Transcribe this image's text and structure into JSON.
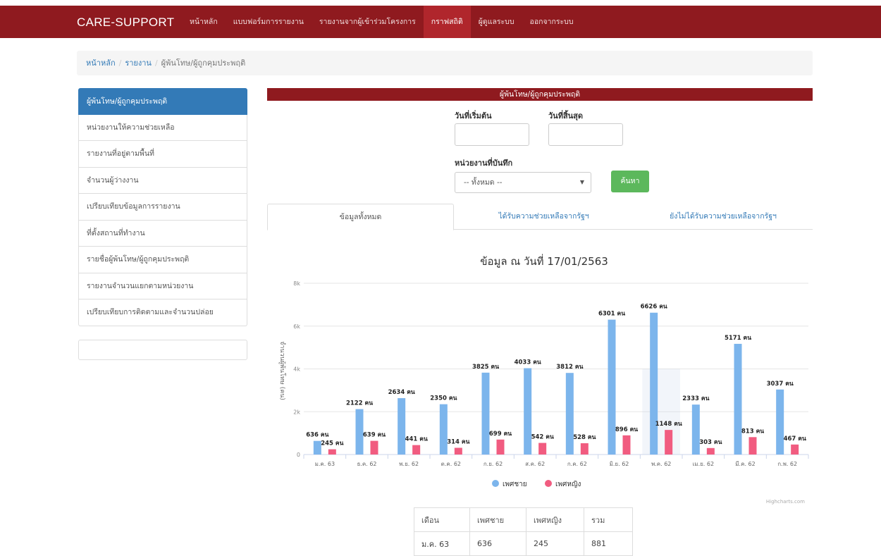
{
  "navbar": {
    "brand": "CARE-SUPPORT",
    "items": [
      {
        "label": "หน้าหลัก"
      },
      {
        "label": "แบบฟอร์มการรายงาน"
      },
      {
        "label": "รายงานจากผู้เข้าร่วมโครงการ"
      },
      {
        "label": "กราฟสถิติ"
      },
      {
        "label": "ผู้ดูแลระบบ"
      },
      {
        "label": "ออกจากระบบ"
      }
    ]
  },
  "breadcrumb": {
    "home": "หน้าหลัก",
    "report": "รายงาน",
    "current": "ผู้พ้นโทษ/ผู้ถูกคุมประพฤติ"
  },
  "sidebar": {
    "items": [
      {
        "label": "ผู้พ้นโทษ/ผู้ถูกคุมประพฤติ"
      },
      {
        "label": "หน่วยงานให้ความช่วยเหลือ"
      },
      {
        "label": "รายงานที่อยู่ตามพื้นที่"
      },
      {
        "label": "จำนวนผู้ว่างงาน"
      },
      {
        "label": "เปรียบเทียบข้อมูลการรายงาน"
      },
      {
        "label": "ที่ตั้งสถานที่ทำงาน"
      },
      {
        "label": "รายชื่อผู้พ้นโทษ/ผู้ถูกคุมประพฤติ"
      },
      {
        "label": "รายงานจำนวนแยกตามหน่วยงาน"
      },
      {
        "label": "เปรียบเทียบการติดตามและจำนวนปล่อย"
      }
    ]
  },
  "panel": {
    "heading": "ผู้พ้นโทษ/ผู้ถูกคุมประพฤติ"
  },
  "form": {
    "start_label": "วันที่เริ่มต้น",
    "end_label": "วันที่สิ้นสุด",
    "unit_label": "หน่วยงานที่บันทึก",
    "unit_value": "-- ทั้งหมด --",
    "search_label": "ค้นหา"
  },
  "tabs": [
    {
      "label": "ข้อมูลทั้งหมด"
    },
    {
      "label": "ได้รับความช่วยเหลือจากรัฐฯ"
    },
    {
      "label": "ยังไม่ได้รับความช่วยเหลือจากรัฐฯ"
    }
  ],
  "chart_data": {
    "type": "bar",
    "title": "ข้อมูล ณ วันที่ 17/01/2563",
    "ylabel": "จำนวนผู้พ้นโทษ (คน)",
    "ylim": [
      0,
      8000
    ],
    "yticks": [
      "0",
      "2k",
      "4k",
      "6k",
      "8k"
    ],
    "categories": [
      "ม.ค. 63",
      "ธ.ค. 62",
      "พ.ย. 62",
      "ต.ค. 62",
      "ก.ย. 62",
      "ส.ค. 62",
      "ก.ค. 62",
      "มิ.ย. 62",
      "พ.ค. 62",
      "เม.ย. 62",
      "มี.ค. 62",
      "ก.พ. 62"
    ],
    "series": [
      {
        "name": "เพศชาย",
        "color": "#7cb5ec",
        "values": [
          636,
          2122,
          2634,
          2350,
          3825,
          4033,
          3812,
          6301,
          6626,
          2333,
          5171,
          3037
        ],
        "labels": [
          "636 คน",
          "2122 คน",
          "2634 คน",
          "2350 คน",
          "3825 คน",
          "4033 คน",
          "3812 คน",
          "6301 คน",
          "6626 คน",
          "2333 คน",
          "5171 คน",
          "3037 คน"
        ]
      },
      {
        "name": "เพศหญิง",
        "color": "#f15c80",
        "values": [
          245,
          639,
          441,
          314,
          699,
          542,
          528,
          896,
          1148,
          303,
          813,
          467
        ],
        "labels": [
          "245 คน",
          "639 คน",
          "441 คน",
          "314 คน",
          "699 คน",
          "542 คน",
          "528 คน",
          "896 คน",
          "1148 คน",
          "303 คน",
          "813 คน",
          "467 คน"
        ]
      }
    ],
    "legend": "bottom-center",
    "grid": true,
    "credit": "Highcharts.com"
  },
  "table": {
    "headers": [
      "เดือน",
      "เพศชาย",
      "เพศหญิง",
      "รวม"
    ],
    "rows": [
      [
        "ม.ค. 63",
        "636",
        "245",
        "881"
      ]
    ]
  }
}
